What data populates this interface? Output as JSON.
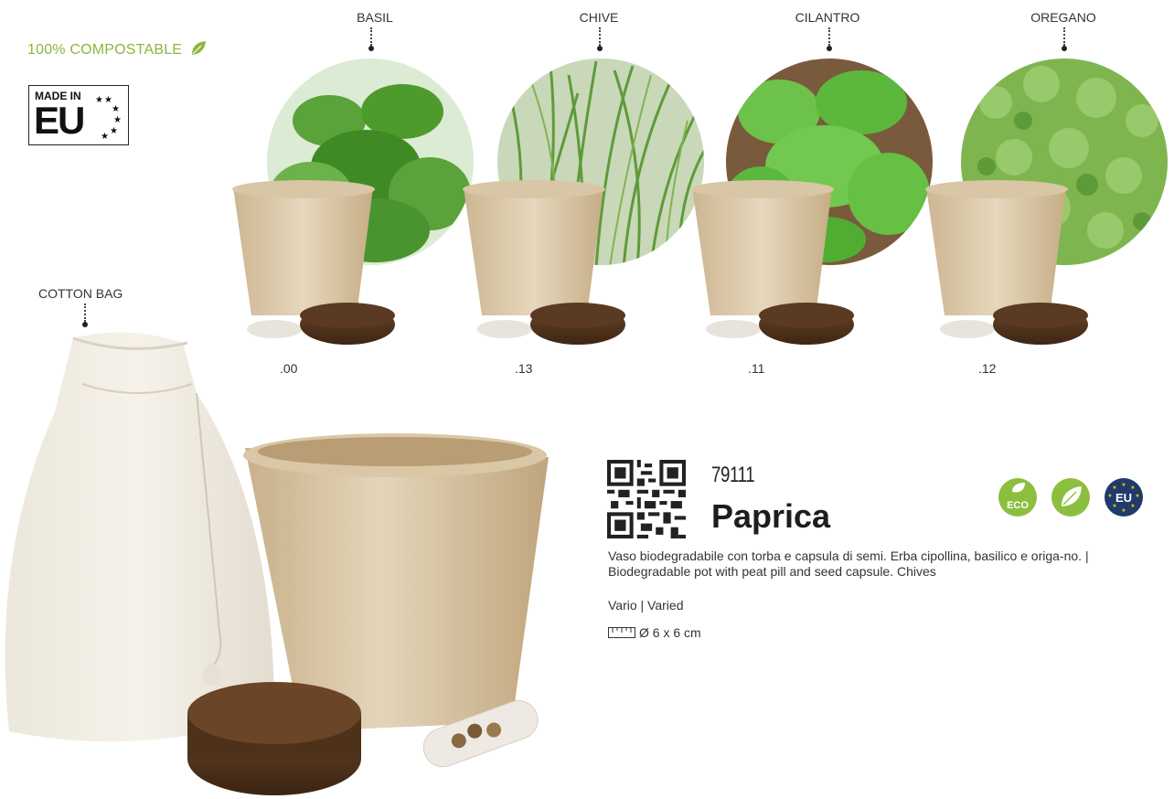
{
  "header": {
    "compostable": "100% COMPOSTABLE",
    "made_in_top": "MADE IN",
    "made_in_bottom": "EU"
  },
  "variants": [
    {
      "name": "BASIL",
      "code": ".00"
    },
    {
      "name": "CHIVE",
      "code": ".13"
    },
    {
      "name": "CILANTRO",
      "code": ".11"
    },
    {
      "name": "OREGANO",
      "code": ".12"
    }
  ],
  "accessory": {
    "label": "COTTON BAG"
  },
  "product": {
    "sku": "79111",
    "name": "Paprica",
    "description": "Vaso biodegradabile con torba e capsula di semi. Erba cipollina, basilico e origa-no. | Biodegradable pot with peat pill and seed capsule. Chives",
    "material": "Vario | Varied",
    "dimensions": "Ø 6 x 6 cm"
  },
  "badges": [
    {
      "name": "eco-badge",
      "label": "ECO",
      "color": "#8dbf3f"
    },
    {
      "name": "vegan-badge",
      "label": "",
      "color": "#8dbf3f"
    },
    {
      "name": "eu-badge",
      "label": "EU",
      "color": "#1f3a6b"
    }
  ],
  "colors": {
    "accent_green": "#8db63c",
    "pot": "#d9c6a6",
    "peat": "#5b3a22",
    "leaf": "#4f9a2c"
  }
}
